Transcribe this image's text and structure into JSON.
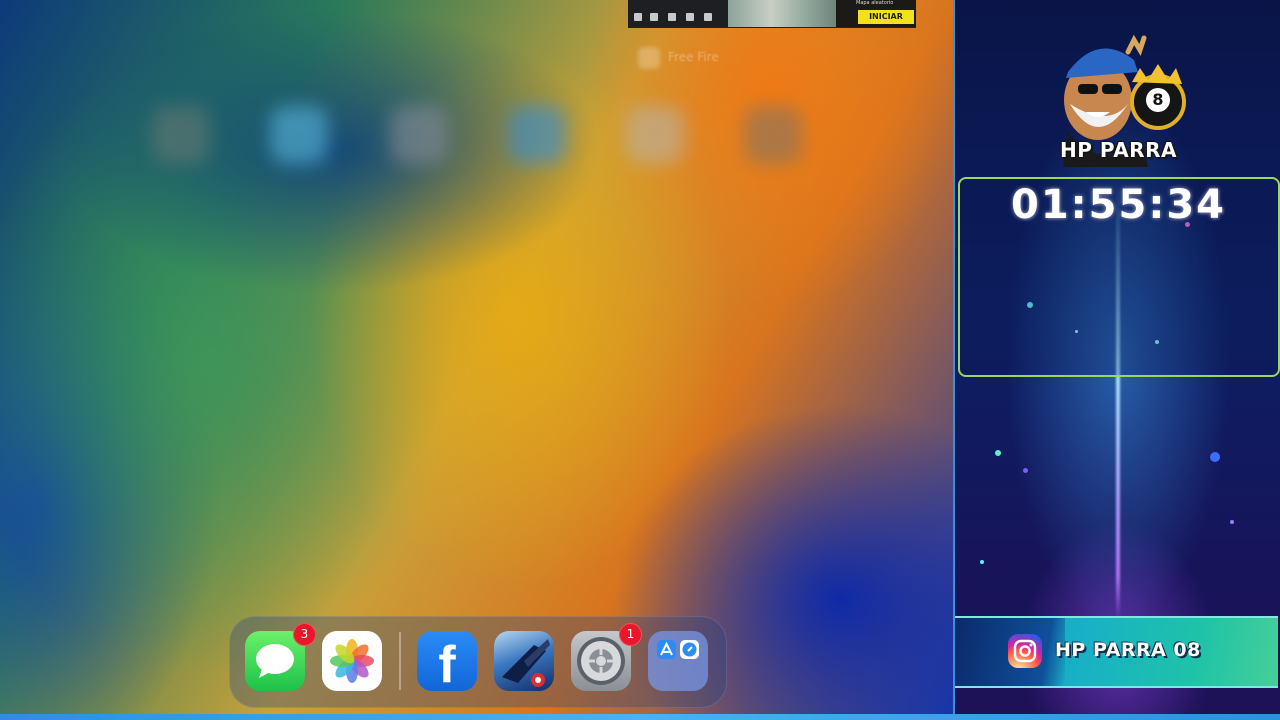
{
  "home_screen": {
    "blurred_app_label": "Free Fire",
    "mini_preview": {
      "start_label": "INICIAR",
      "mode_text": "Mapa aleatorio"
    }
  },
  "dock": {
    "apps": [
      {
        "name": "Messages",
        "icon": "messages-icon",
        "badge": "3"
      },
      {
        "name": "Photos",
        "icon": "photos-icon"
      },
      {
        "name": "Facebook",
        "icon": "facebook-icon"
      },
      {
        "name": "Free Fire",
        "icon": "free-fire-icon"
      },
      {
        "name": "Settings",
        "icon": "settings-icon",
        "badge": "1"
      },
      {
        "name": "App Library",
        "icon": "app-library-icon"
      }
    ],
    "badges": {
      "messages": "3",
      "settings": "1"
    },
    "facebook_glyph": "f"
  },
  "overlay": {
    "logo_text": "HP PARRA",
    "logo_ball_number": "8",
    "timer": "01:55:34",
    "instagram_handle": "HP PARRA 08"
  },
  "colors": {
    "timer_frame": "#9cd65a",
    "badge_red": "#e8182a",
    "start_yellow": "#f3e11c"
  }
}
